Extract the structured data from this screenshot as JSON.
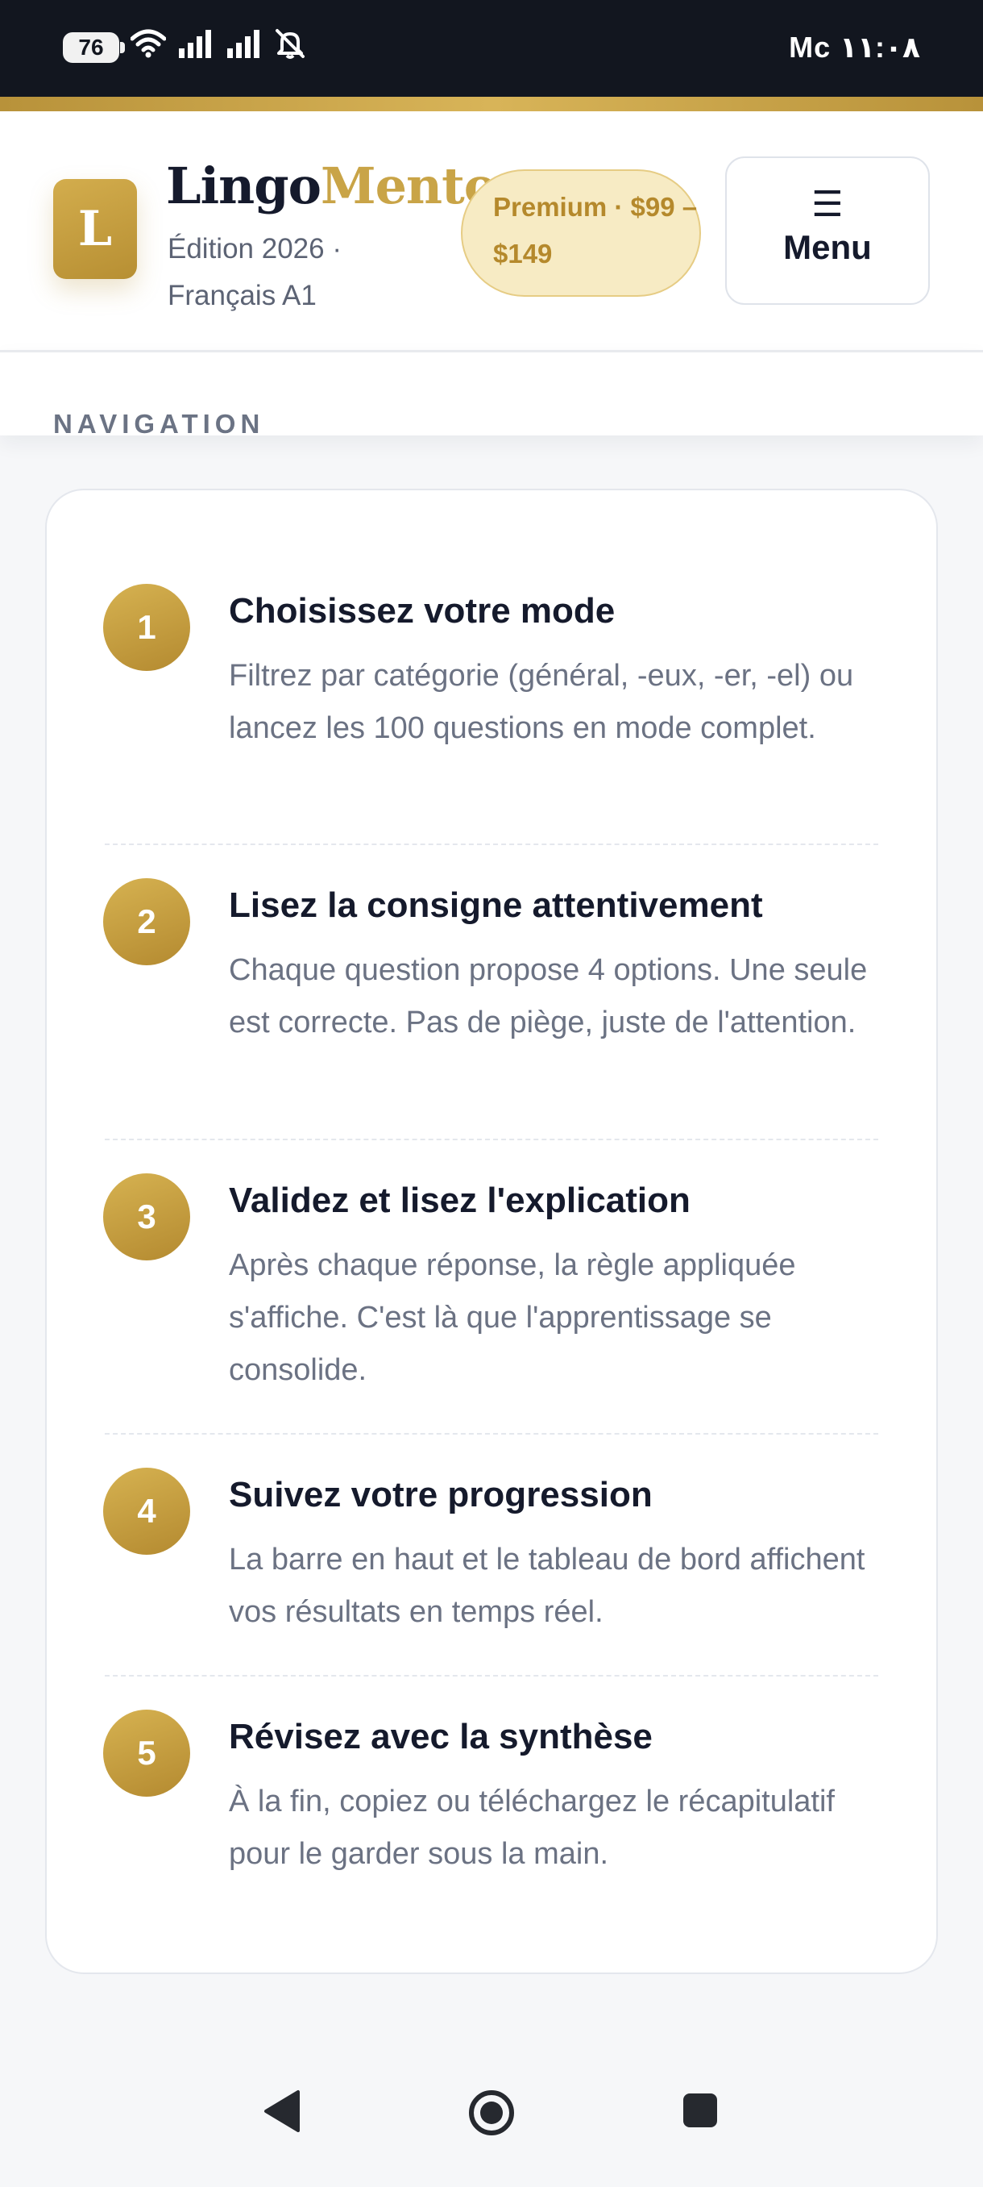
{
  "status_bar": {
    "battery": "76",
    "clock": "Mc ١١:٠٨",
    "icons": [
      "wifi-icon",
      "signal-icon",
      "signal-icon",
      "bell-off-icon"
    ]
  },
  "header": {
    "logo_letter": "L",
    "brand_part1": "Lingo",
    "brand_part2": "Mento",
    "edition": "Édition 2026 · Français A1",
    "premium": "Premium · $99 – $149",
    "menu_icon": "☰",
    "menu_label": "Menu"
  },
  "nav": {
    "label": "NAVIGATION"
  },
  "steps": [
    {
      "number": "1",
      "title": "Choisissez votre mode",
      "description": "Filtrez par catégorie (général, -eux, -er, -el) ou lancez les 100 questions en mode complet."
    },
    {
      "number": "2",
      "title": "Lisez la consigne attentivement",
      "description": "Chaque question propose 4 options. Une seule est correcte. Pas de piège, juste de l'attention."
    },
    {
      "number": "3",
      "title": "Validez et lisez l'explication",
      "description": "Après chaque réponse, la règle appliquée s'affiche. C'est là que l'apprentissage se consolide."
    },
    {
      "number": "4",
      "title": "Suivez votre progression",
      "description": "La barre en haut et le tableau de bord affichent vos résultats en temps réel."
    },
    {
      "number": "5",
      "title": "Révisez avec la synthèse",
      "description": "À la fin, copiez ou téléchargez le récapitulatif pour le garder sous la main."
    }
  ],
  "colors": {
    "gold": "#c9a447",
    "dark": "#151a2c",
    "muted": "#6b7283"
  }
}
